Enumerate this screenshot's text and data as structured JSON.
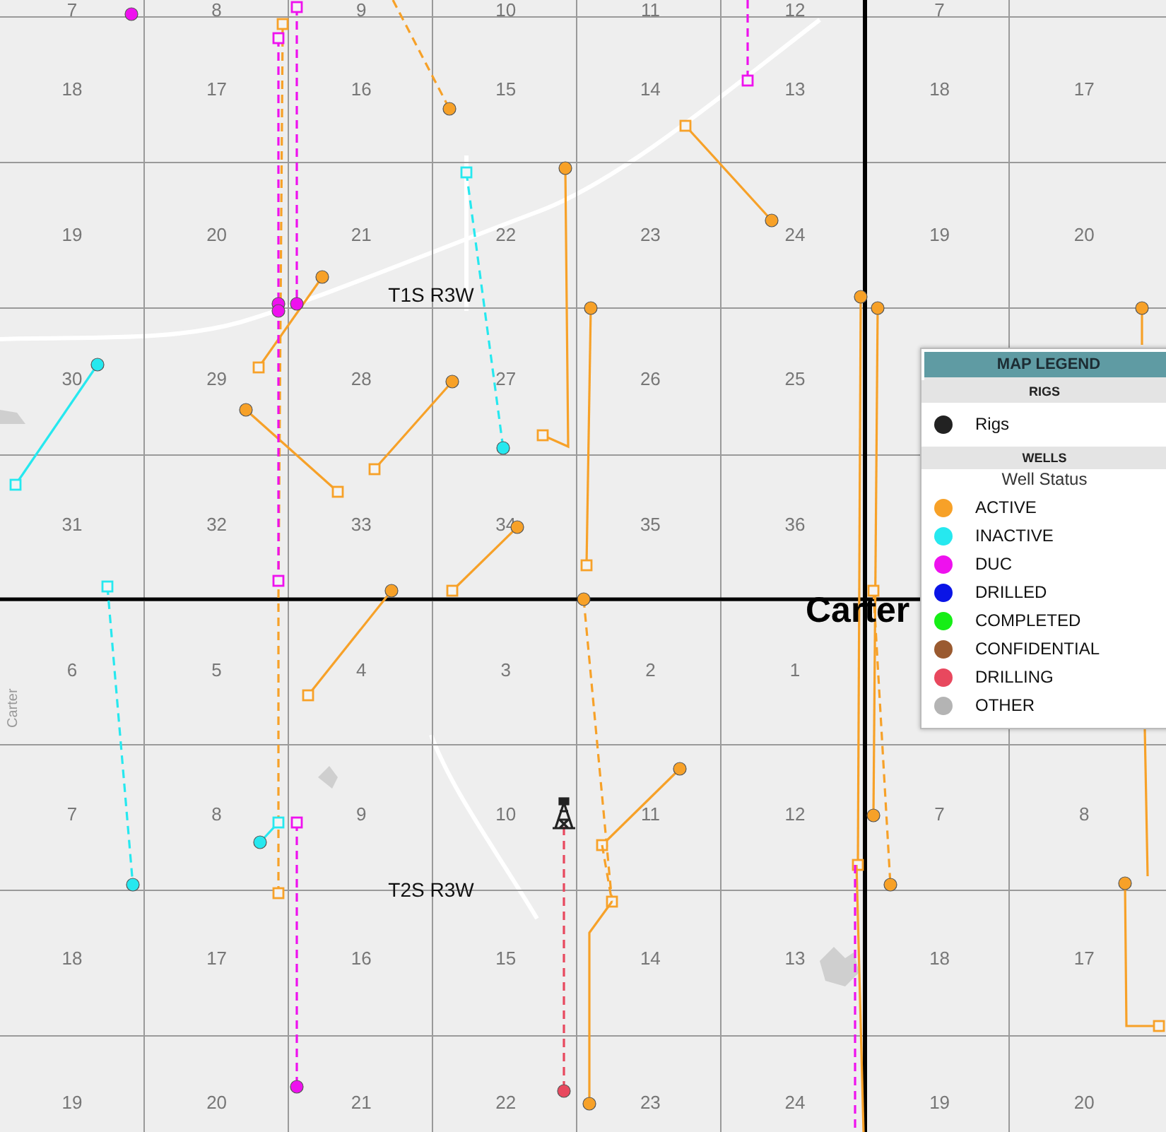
{
  "map": {
    "section_rows": [
      [
        "7",
        "8",
        "9",
        "10",
        "11",
        "12",
        "7"
      ],
      [
        "18",
        "17",
        "16",
        "15",
        "14",
        "13",
        "18",
        "17"
      ],
      [
        "19",
        "20",
        "21",
        "22",
        "23",
        "24",
        "19",
        "20"
      ],
      [
        "30",
        "29",
        "28",
        "27",
        "26",
        "25"
      ],
      [
        "31",
        "32",
        "33",
        "34",
        "35",
        "36"
      ],
      [
        "6",
        "5",
        "4",
        "3",
        "2",
        "1"
      ],
      [
        "7",
        "8",
        "9",
        "10",
        "11",
        "12",
        "7",
        "8"
      ],
      [
        "18",
        "17",
        "16",
        "15",
        "14",
        "13",
        "18",
        "17"
      ],
      [
        "19",
        "20",
        "21",
        "22",
        "23",
        "24",
        "19",
        "20"
      ]
    ],
    "township_labels": [
      "T1S R3W",
      "T2S R3W"
    ],
    "county_label": "Carter",
    "county_label_vertical": "Carter"
  },
  "legend": {
    "title": "MAP LEGEND",
    "sections": [
      {
        "heading": "RIGS",
        "items": [
          {
            "label": "Rigs",
            "color": "#222222"
          }
        ]
      },
      {
        "heading": "WELLS",
        "subheading": "Well Status",
        "items": [
          {
            "label": "ACTIVE",
            "color": "#f7a128"
          },
          {
            "label": "INACTIVE",
            "color": "#26e8ef"
          },
          {
            "label": "DUC",
            "color": "#ee11ee"
          },
          {
            "label": "DRILLED",
            "color": "#0a14e6"
          },
          {
            "label": "COMPLETED",
            "color": "#16ee16"
          },
          {
            "label": "CONFIDENTIAL",
            "color": "#9a5a30"
          },
          {
            "label": "DRILLING",
            "color": "#e8485e"
          },
          {
            "label": "OTHER",
            "color": "#b4b4b4"
          }
        ]
      }
    ]
  }
}
